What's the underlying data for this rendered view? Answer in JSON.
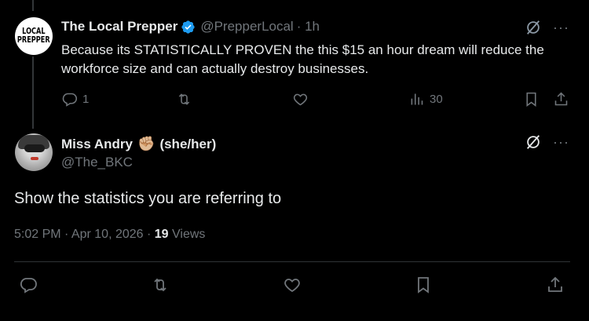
{
  "tweet1": {
    "avatar_text_line1": "LOCAL",
    "avatar_text_line2": "PREPPER",
    "name": "The Local Prepper",
    "handle": "@PrepperLocal",
    "time": "· 1h",
    "text": "Because its STATISTICALLY PROVEN the this $15 an hour dream will reduce the workforce size and can actually destroy businesses.",
    "replies": "1",
    "views": "30",
    "verified_color": "#1d9bf0"
  },
  "tweet2": {
    "name": "Miss Andry",
    "emoji": "✊🏼",
    "pronouns": "(she/her)",
    "handle": "@The_BKC",
    "text": "Show the statistics you are referring to",
    "time_date": "5:02 PM · Apr 10, 2026 · ",
    "views_count": "19",
    "views_label": " Views"
  },
  "icons": {
    "more": "···",
    "grok": "grok-icon",
    "reply": "reply-icon",
    "retweet": "retweet-icon",
    "like": "heart-icon",
    "views": "views-icon",
    "bookmark": "bookmark-icon",
    "share": "share-icon"
  },
  "colors": {
    "background": "#000000",
    "text": "#e7e9ea",
    "muted": "#71767b",
    "accent": "#1d9bf0"
  }
}
